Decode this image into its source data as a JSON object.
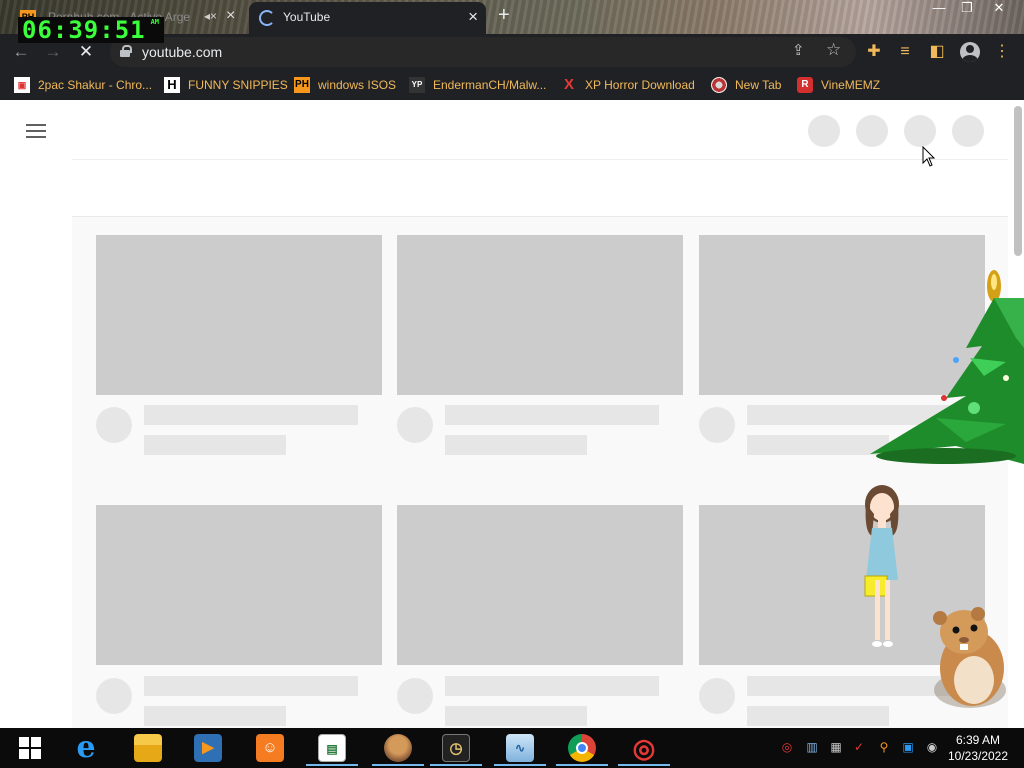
{
  "overlay_clock": {
    "time": "06:39:51",
    "ampm": "AM"
  },
  "tabs": [
    {
      "title": "Pornhub.com - Active Arge",
      "favicon": "PH",
      "muted": true,
      "active": false
    },
    {
      "title": "YouTube",
      "active": true,
      "loading": true
    }
  ],
  "toolbar": {
    "url": "youtube.com"
  },
  "bookmarks": [
    {
      "label": "2pac Shakur - Chro...",
      "icon": "store-icon"
    },
    {
      "label": "FUNNY SNIPPIES",
      "icon": "H"
    },
    {
      "label": "windows ISOS",
      "icon": "PH"
    },
    {
      "label": "EndermanCH/Malw...",
      "icon": "YP"
    },
    {
      "label": "XP Horror Download",
      "icon": "X"
    },
    {
      "label": "New Tab",
      "icon": "globe-icon"
    },
    {
      "label": "VineMEMZ",
      "icon": "R"
    }
  ],
  "taskbar": {
    "apps": [
      "start",
      "internet-explorer",
      "file-explorer",
      "media-player",
      "uc-browser",
      "app-window",
      "hamster-app",
      "clock-app",
      "resource-monitor",
      "chrome",
      "spinner-app"
    ],
    "time": "6:39 AM",
    "date": "10/23/2022"
  },
  "colors": {
    "accent_link": "#f1b95a",
    "toolbar_bg": "#202124",
    "placeholder": "#cccccc"
  }
}
